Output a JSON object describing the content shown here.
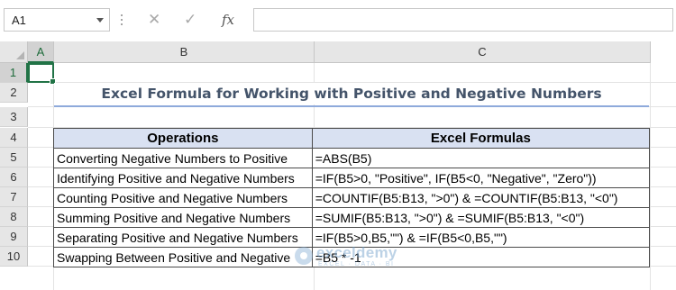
{
  "formula_bar": {
    "name_box": "A1",
    "fx_label": "fx",
    "formula": ""
  },
  "columns": [
    "A",
    "B",
    "C"
  ],
  "rows": [
    "1",
    "2",
    "3",
    "4",
    "5",
    "6",
    "7",
    "8",
    "9",
    "10"
  ],
  "selected_cell": "A1",
  "title": "Excel Formula for Working with Positive and Negative Numbers",
  "table": {
    "headers": [
      "Operations",
      "Excel Formulas"
    ],
    "rows": [
      [
        "Converting Negative Numbers to Positive",
        "=ABS(B5)"
      ],
      [
        "Identifying Positive and Negative Numbers",
        "=IF(B5>0, \"Positive\", IF(B5<0, \"Negative\", \"Zero\"))"
      ],
      [
        "Counting Positive and Negative Numbers",
        "=COUNTIF(B5:B13, \">0\") & =COUNTIF(B5:B13, \"<0\")"
      ],
      [
        "Summing Positive and Negative Numbers",
        "=SUMIF(B5:B13, \">0\") & =SUMIF(B5:B13, \"<0\")"
      ],
      [
        "Separating Positive and Negative Numbers",
        "=IF(B5>0,B5,\"\") & =IF(B5<0,B5,\"\")"
      ],
      [
        "Swapping Between Positive and Negative",
        "=B5 * -1"
      ]
    ]
  },
  "watermark": {
    "name": "exceldemy",
    "tagline": "EXCEL · DATA · BI"
  },
  "colors": {
    "accent_green": "#217346",
    "header_fill": "#d9e1f2",
    "title_color": "#44546a",
    "title_underline": "#8eaadb"
  }
}
